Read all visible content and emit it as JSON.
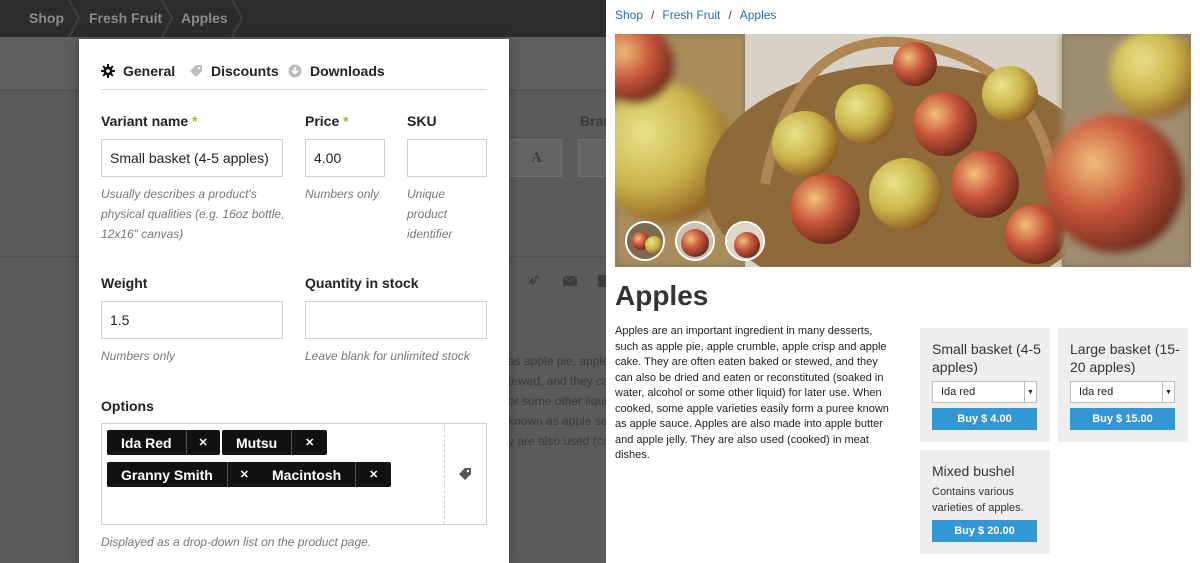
{
  "admin": {
    "breadcrumbs": [
      "Shop",
      "Fresh Fruit",
      "Apples"
    ],
    "ghost": {
      "brand_label": "Bran",
      "text_lines": [
        "as apple pie, apple c",
        "tewed, and they ca",
        "or some other liquid",
        "known as apple sau",
        "y are also used (coo"
      ]
    }
  },
  "modal": {
    "tabs": {
      "general": "General",
      "discounts": "Discounts",
      "downloads": "Downloads"
    },
    "variant_name": {
      "label": "Variant name",
      "required_mark": "*",
      "value": "Small basket (4-5 apples)",
      "hint_lines": [
        "Usually describes a product's",
        "physical qualities (e.g. 16oz bottle,",
        "12x16\" canvas)"
      ]
    },
    "price": {
      "label": "Price",
      "required_mark": "*",
      "value": "4.00",
      "hint": "Numbers only"
    },
    "sku": {
      "label": "SKU",
      "value": "",
      "hint_lines": [
        "Unique",
        "product",
        "identifier"
      ]
    },
    "weight": {
      "label": "Weight",
      "value": "1.5",
      "hint": "Numbers only"
    },
    "quantity": {
      "label": "Quantity in stock",
      "value": "",
      "hint": "Leave blank for unlimited stock"
    },
    "options": {
      "label": "Options",
      "chips": [
        "Ida Red",
        "Mutsu",
        "Granny Smith",
        "Macintosh"
      ],
      "remove_glyph": "✕",
      "hint": "Displayed as a drop-down list on the product page."
    }
  },
  "store": {
    "breadcrumbs": [
      "Shop",
      "Fresh Fruit",
      "Apples"
    ],
    "breadcrumb_separator": "/",
    "title": "Apples",
    "description": "Apples are an important ingredient in many desserts, such as apple pie, apple crumble, apple crisp and apple cake. They are often eaten baked or stewed, and they can also be dried and eaten or reconstituted (soaked in water, alcohol or some other liquid) for later use. When cooked, some apple varieties easily form a puree known as apple sauce. Apples are also made into apple butter and apple jelly. They are also used (cooked) in meat dishes.",
    "cards": {
      "small": {
        "title": "Small basket (4-5 apples)",
        "select": "Ida red",
        "button": "Buy $ 4.00"
      },
      "large": {
        "title": "Large basket (15-20 apples)",
        "select": "Ida red",
        "button": "Buy $ 15.00"
      },
      "mixed": {
        "title": "Mixed bushel",
        "subtitle": "Contains various varieties of apples.",
        "button": "Buy $ 20.00"
      }
    }
  },
  "colors": {
    "accent_button": "#3397d6",
    "required": "#8fc31f",
    "link": "#1e6ea8",
    "admin_bg": "#5a5a5a"
  }
}
